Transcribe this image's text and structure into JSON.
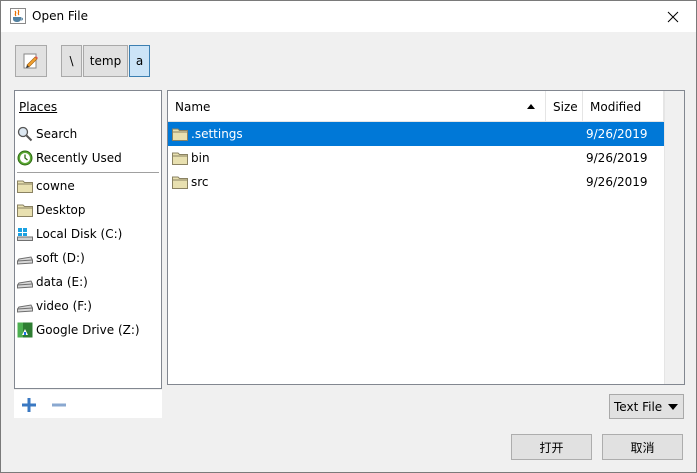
{
  "window": {
    "title": "Open File"
  },
  "path": {
    "crumbs": [
      "\\",
      "temp",
      "a"
    ]
  },
  "places": {
    "header": "Places",
    "items": [
      {
        "label": "Search",
        "icon": "search-icon"
      },
      {
        "label": "Recently Used",
        "icon": "recent-icon"
      },
      {
        "label": "cowne",
        "icon": "folder-icon"
      },
      {
        "label": "Desktop",
        "icon": "folder-icon"
      },
      {
        "label": "Local Disk (C:)",
        "icon": "windows-drive-icon"
      },
      {
        "label": "soft (D:)",
        "icon": "drive-icon"
      },
      {
        "label": "data (E:)",
        "icon": "drive-icon"
      },
      {
        "label": "video (F:)",
        "icon": "drive-icon"
      },
      {
        "label": "Google Drive (Z:)",
        "icon": "google-drive-icon"
      }
    ]
  },
  "files": {
    "columns": {
      "name": "Name",
      "size": "Size",
      "modified": "Modified"
    },
    "rows": [
      {
        "name": ".settings",
        "size": "",
        "modified": "9/26/2019",
        "selected": true
      },
      {
        "name": "bin",
        "size": "",
        "modified": "9/26/2019",
        "selected": false
      },
      {
        "name": "src",
        "size": "",
        "modified": "9/26/2019",
        "selected": false
      }
    ]
  },
  "filter": {
    "selected": "Text File"
  },
  "buttons": {
    "open": "打开",
    "cancel": "取消"
  },
  "colors": {
    "selection": "#0078d7",
    "folder": "#e8d8a0"
  }
}
